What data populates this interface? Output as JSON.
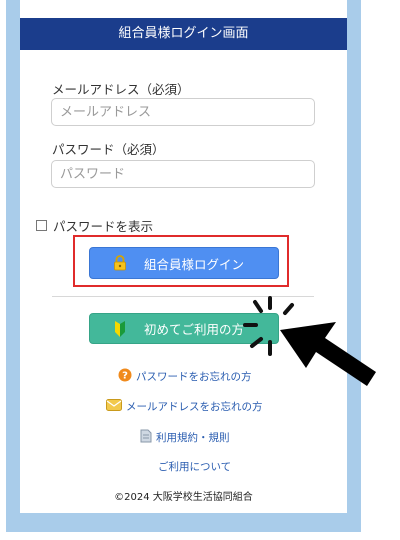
{
  "header": {
    "title": "組合員様ログイン画面"
  },
  "form": {
    "email_label": "メールアドレス（必須）",
    "email_placeholder": "メールアドレス",
    "password_label": "パスワード（必須）",
    "password_placeholder": "パスワード",
    "show_password_label": "パスワードを表示"
  },
  "buttons": {
    "login_label": "組合員様ログイン",
    "first_time_label": "初めてご利用の方"
  },
  "links": {
    "forgot_password": "パスワードをお忘れの方",
    "forgot_email": "メールアドレスをお忘れの方",
    "terms": "利用規約・規則",
    "about": "ご利用について"
  },
  "footer": {
    "copyright": "©2024 大阪学校生活協同組合"
  },
  "colors": {
    "header_bg": "#1b3d8c",
    "login_button": "#4f8ff2",
    "first_time_button": "#43b89a",
    "highlight_border": "#e02b2b"
  },
  "icons": {
    "login_button": "lock-icon",
    "first_time_button": "beginner-mark-icon",
    "forgot_password": "question-icon",
    "forgot_email": "envelope-icon",
    "terms": "document-icon"
  }
}
